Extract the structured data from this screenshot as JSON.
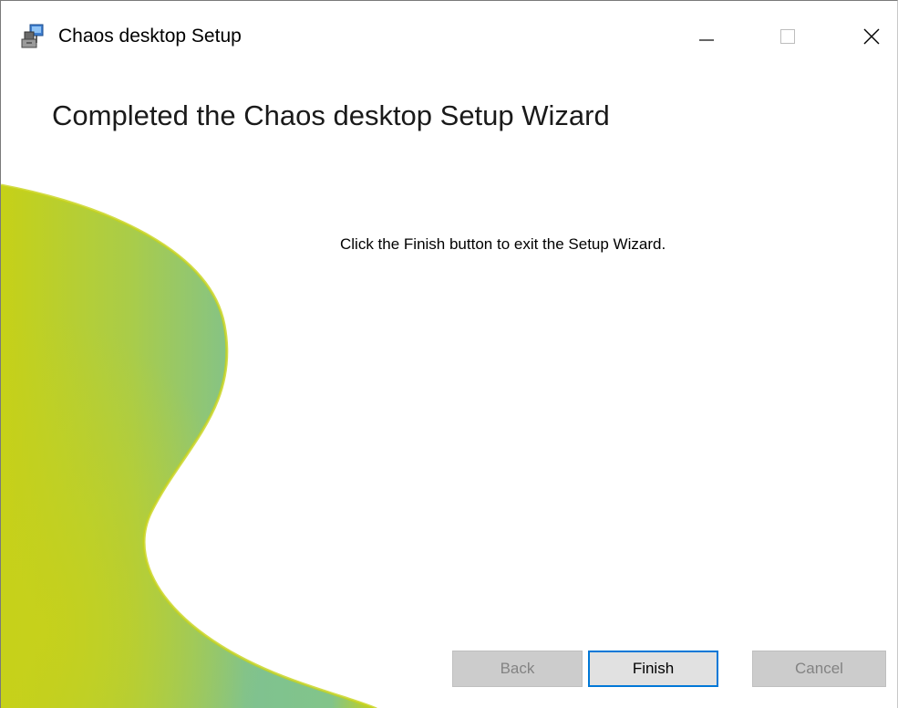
{
  "window": {
    "title": "Chaos desktop Setup",
    "controls": {
      "minimize": "minimize",
      "maximize": "maximize",
      "close": "close"
    }
  },
  "content": {
    "heading": "Completed the Chaos desktop Setup Wizard",
    "message": "Click the Finish button to exit the Setup Wizard."
  },
  "buttons": {
    "back": "Back",
    "finish": "Finish",
    "cancel": "Cancel"
  },
  "colors": {
    "graphic_yellow": "#c6d117",
    "graphic_green": "#7fc290",
    "focus_border": "#0078d7"
  },
  "icons": {
    "app": "installer-icon",
    "minimize": "minimize-icon",
    "maximize": "maximize-icon",
    "close": "close-icon"
  }
}
